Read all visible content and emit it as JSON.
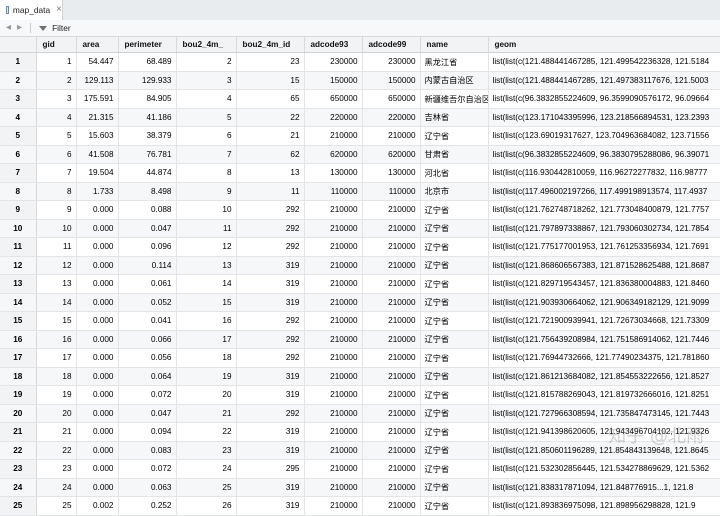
{
  "tab": {
    "label": "map_data",
    "close_glyph": "×"
  },
  "toolbar": {
    "filter_label": "Filter"
  },
  "columns": [
    "",
    "gid",
    "area",
    "perimeter",
    "bou2_4m_",
    "bou2_4m_id",
    "adcode93",
    "adcode99",
    "name",
    "geom"
  ],
  "rows": [
    [
      "1",
      "1",
      "54.447",
      "68.489",
      "2",
      "23",
      "230000",
      "230000",
      "黑龙江省",
      "list(list(c(121.488441467285, 121.499542236328, 121.5184"
    ],
    [
      "2",
      "2",
      "129.113",
      "129.933",
      "3",
      "15",
      "150000",
      "150000",
      "内蒙古自治区",
      "list(list(c(121.488441467285, 121.497383117676, 121.5003"
    ],
    [
      "3",
      "3",
      "175.591",
      "84.905",
      "4",
      "65",
      "650000",
      "650000",
      "新疆维吾尔自治区",
      "list(list(c(96.3832855224609, 96.3599090576172, 96.09664"
    ],
    [
      "4",
      "4",
      "21.315",
      "41.186",
      "5",
      "22",
      "220000",
      "220000",
      "吉林省",
      "list(list(c(123.171043395996, 123.218566894531, 123.2393"
    ],
    [
      "5",
      "5",
      "15.603",
      "38.379",
      "6",
      "21",
      "210000",
      "210000",
      "辽宁省",
      "list(list(c(123.69019317627, 123.704963684082, 123.71556"
    ],
    [
      "6",
      "6",
      "41.508",
      "76.781",
      "7",
      "62",
      "620000",
      "620000",
      "甘肃省",
      "list(list(c(96.3832855224609, 96.3830795288086, 96.39071"
    ],
    [
      "7",
      "7",
      "19.504",
      "44.874",
      "8",
      "13",
      "130000",
      "130000",
      "河北省",
      "list(list(c(116.930442810059, 116.96272277832, 116.98777"
    ],
    [
      "8",
      "8",
      "1.733",
      "8.498",
      "9",
      "11",
      "110000",
      "110000",
      "北京市",
      "list(list(c(117.496002197266, 117.499198913574, 117.4937"
    ],
    [
      "9",
      "9",
      "0.000",
      "0.088",
      "10",
      "292",
      "210000",
      "210000",
      "辽宁省",
      "list(list(c(121.762748718262, 121.773048400879, 121.7757"
    ],
    [
      "10",
      "10",
      "0.000",
      "0.047",
      "11",
      "292",
      "210000",
      "210000",
      "辽宁省",
      "list(list(c(121.797897338867, 121.793060302734, 121.7854"
    ],
    [
      "11",
      "11",
      "0.000",
      "0.096",
      "12",
      "292",
      "210000",
      "210000",
      "辽宁省",
      "list(list(c(121.775177001953, 121.761253356934, 121.7691"
    ],
    [
      "12",
      "12",
      "0.000",
      "0.114",
      "13",
      "319",
      "210000",
      "210000",
      "辽宁省",
      "list(list(c(121.868606567383, 121.871528625488, 121.8687"
    ],
    [
      "13",
      "13",
      "0.000",
      "0.061",
      "14",
      "319",
      "210000",
      "210000",
      "辽宁省",
      "list(list(c(121.829719543457, 121.836380004883, 121.8460"
    ],
    [
      "14",
      "14",
      "0.000",
      "0.052",
      "15",
      "319",
      "210000",
      "210000",
      "辽宁省",
      "list(list(c(121.903930664062, 121.906349182129, 121.9099"
    ],
    [
      "15",
      "15",
      "0.000",
      "0.041",
      "16",
      "292",
      "210000",
      "210000",
      "辽宁省",
      "list(list(c(121.721900939941, 121.72673034668, 121.73309"
    ],
    [
      "16",
      "16",
      "0.000",
      "0.066",
      "17",
      "292",
      "210000",
      "210000",
      "辽宁省",
      "list(list(c(121.756439208984, 121.751586914062, 121.7446"
    ],
    [
      "17",
      "17",
      "0.000",
      "0.056",
      "18",
      "292",
      "210000",
      "210000",
      "辽宁省",
      "list(list(c(121.76944732666, 121.77490234375, 121.781860"
    ],
    [
      "18",
      "18",
      "0.000",
      "0.064",
      "19",
      "319",
      "210000",
      "210000",
      "辽宁省",
      "list(list(c(121.861213684082, 121.854553222656, 121.8527"
    ],
    [
      "19",
      "19",
      "0.000",
      "0.072",
      "20",
      "319",
      "210000",
      "210000",
      "辽宁省",
      "list(list(c(121.815788269043, 121.819732666016, 121.8251"
    ],
    [
      "20",
      "20",
      "0.000",
      "0.047",
      "21",
      "292",
      "210000",
      "210000",
      "辽宁省",
      "list(list(c(121.727966308594, 121.735847473145, 121.7443"
    ],
    [
      "21",
      "21",
      "0.000",
      "0.094",
      "22",
      "319",
      "210000",
      "210000",
      "辽宁省",
      "list(list(c(121.941398620605, 121.943496704102, 121.9326"
    ],
    [
      "22",
      "22",
      "0.000",
      "0.083",
      "23",
      "319",
      "210000",
      "210000",
      "辽宁省",
      "list(list(c(121.850601196289, 121.854843139648, 121.8645"
    ],
    [
      "23",
      "23",
      "0.000",
      "0.072",
      "24",
      "295",
      "210000",
      "210000",
      "辽宁省",
      "list(list(c(121.532302856445, 121.534278869629, 121.5362"
    ],
    [
      "24",
      "24",
      "0.000",
      "0.063",
      "25",
      "319",
      "210000",
      "210000",
      "辽宁省",
      "list(list(c(121.838317871094, 121.848776915...1, 121.8"
    ],
    [
      "25",
      "25",
      "0.002",
      "0.252",
      "26",
      "319",
      "210000",
      "210000",
      "辽宁省",
      "list(list(c(121.893836975098, 121.898956298828, 121.9"
    ]
  ],
  "watermark": "知乎 @北雨"
}
